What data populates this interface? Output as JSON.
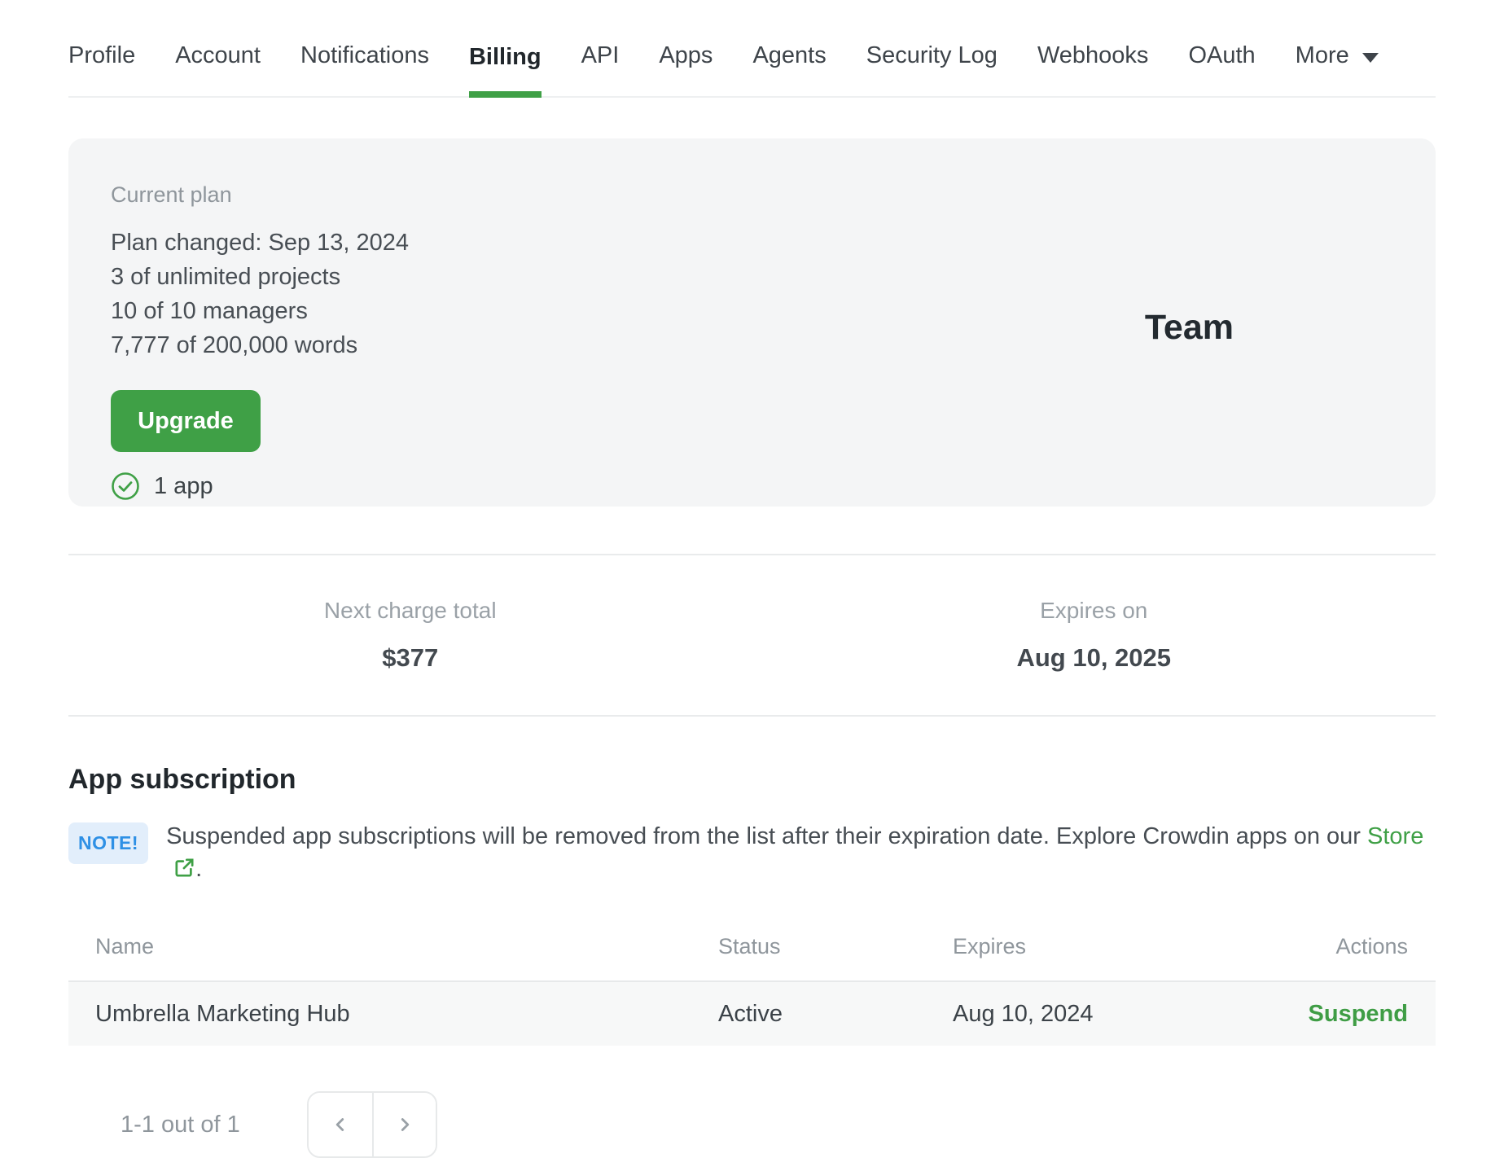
{
  "tabs": {
    "items": [
      {
        "label": "Profile",
        "active": false
      },
      {
        "label": "Account",
        "active": false
      },
      {
        "label": "Notifications",
        "active": false
      },
      {
        "label": "Billing",
        "active": true
      },
      {
        "label": "API",
        "active": false
      },
      {
        "label": "Apps",
        "active": false
      },
      {
        "label": "Agents",
        "active": false
      },
      {
        "label": "Security Log",
        "active": false
      },
      {
        "label": "Webhooks",
        "active": false
      },
      {
        "label": "OAuth",
        "active": false
      }
    ],
    "more_label": "More"
  },
  "current_plan": {
    "label": "Current plan",
    "details": [
      "Plan changed: Sep 13, 2024",
      "3 of unlimited projects",
      "10 of 10 managers",
      "7,777 of 200,000 words"
    ],
    "upgrade_label": "Upgrade",
    "apps_count": "1 app",
    "plan_name": "Team"
  },
  "billing_summary": {
    "next_charge": {
      "label": "Next charge total",
      "value": "$377"
    },
    "expires": {
      "label": "Expires on",
      "value": "Aug 10, 2025"
    }
  },
  "app_subscription": {
    "title": "App subscription",
    "note_badge": "NOTE!",
    "note_text": "Suspended app subscriptions will be removed from the list after their expiration date. Explore Crowdin apps on our",
    "store_link": "Store",
    "note_suffix": ".",
    "table": {
      "headers": [
        "Name",
        "Status",
        "Expires",
        "Actions"
      ],
      "rows": [
        {
          "name": "Umbrella Marketing Hub",
          "status": "Active",
          "expires": "Aug 10, 2024",
          "action": "Suspend"
        }
      ]
    },
    "pagination": {
      "summary": "1-1 out of 1"
    }
  },
  "icons": {
    "check_circle": "check-circle-icon",
    "external_link": "external-link-icon",
    "chevron_down": "chevron-down-icon",
    "chevron_left": "chevron-left-icon",
    "chevron_right": "chevron-right-icon"
  },
  "colors": {
    "accent_green": "#3fa046",
    "note_blue": "#2e90e5",
    "note_badge_bg": "#e2eefb",
    "card_bg": "#f4f5f6",
    "row_bg": "#f7f8f8"
  }
}
